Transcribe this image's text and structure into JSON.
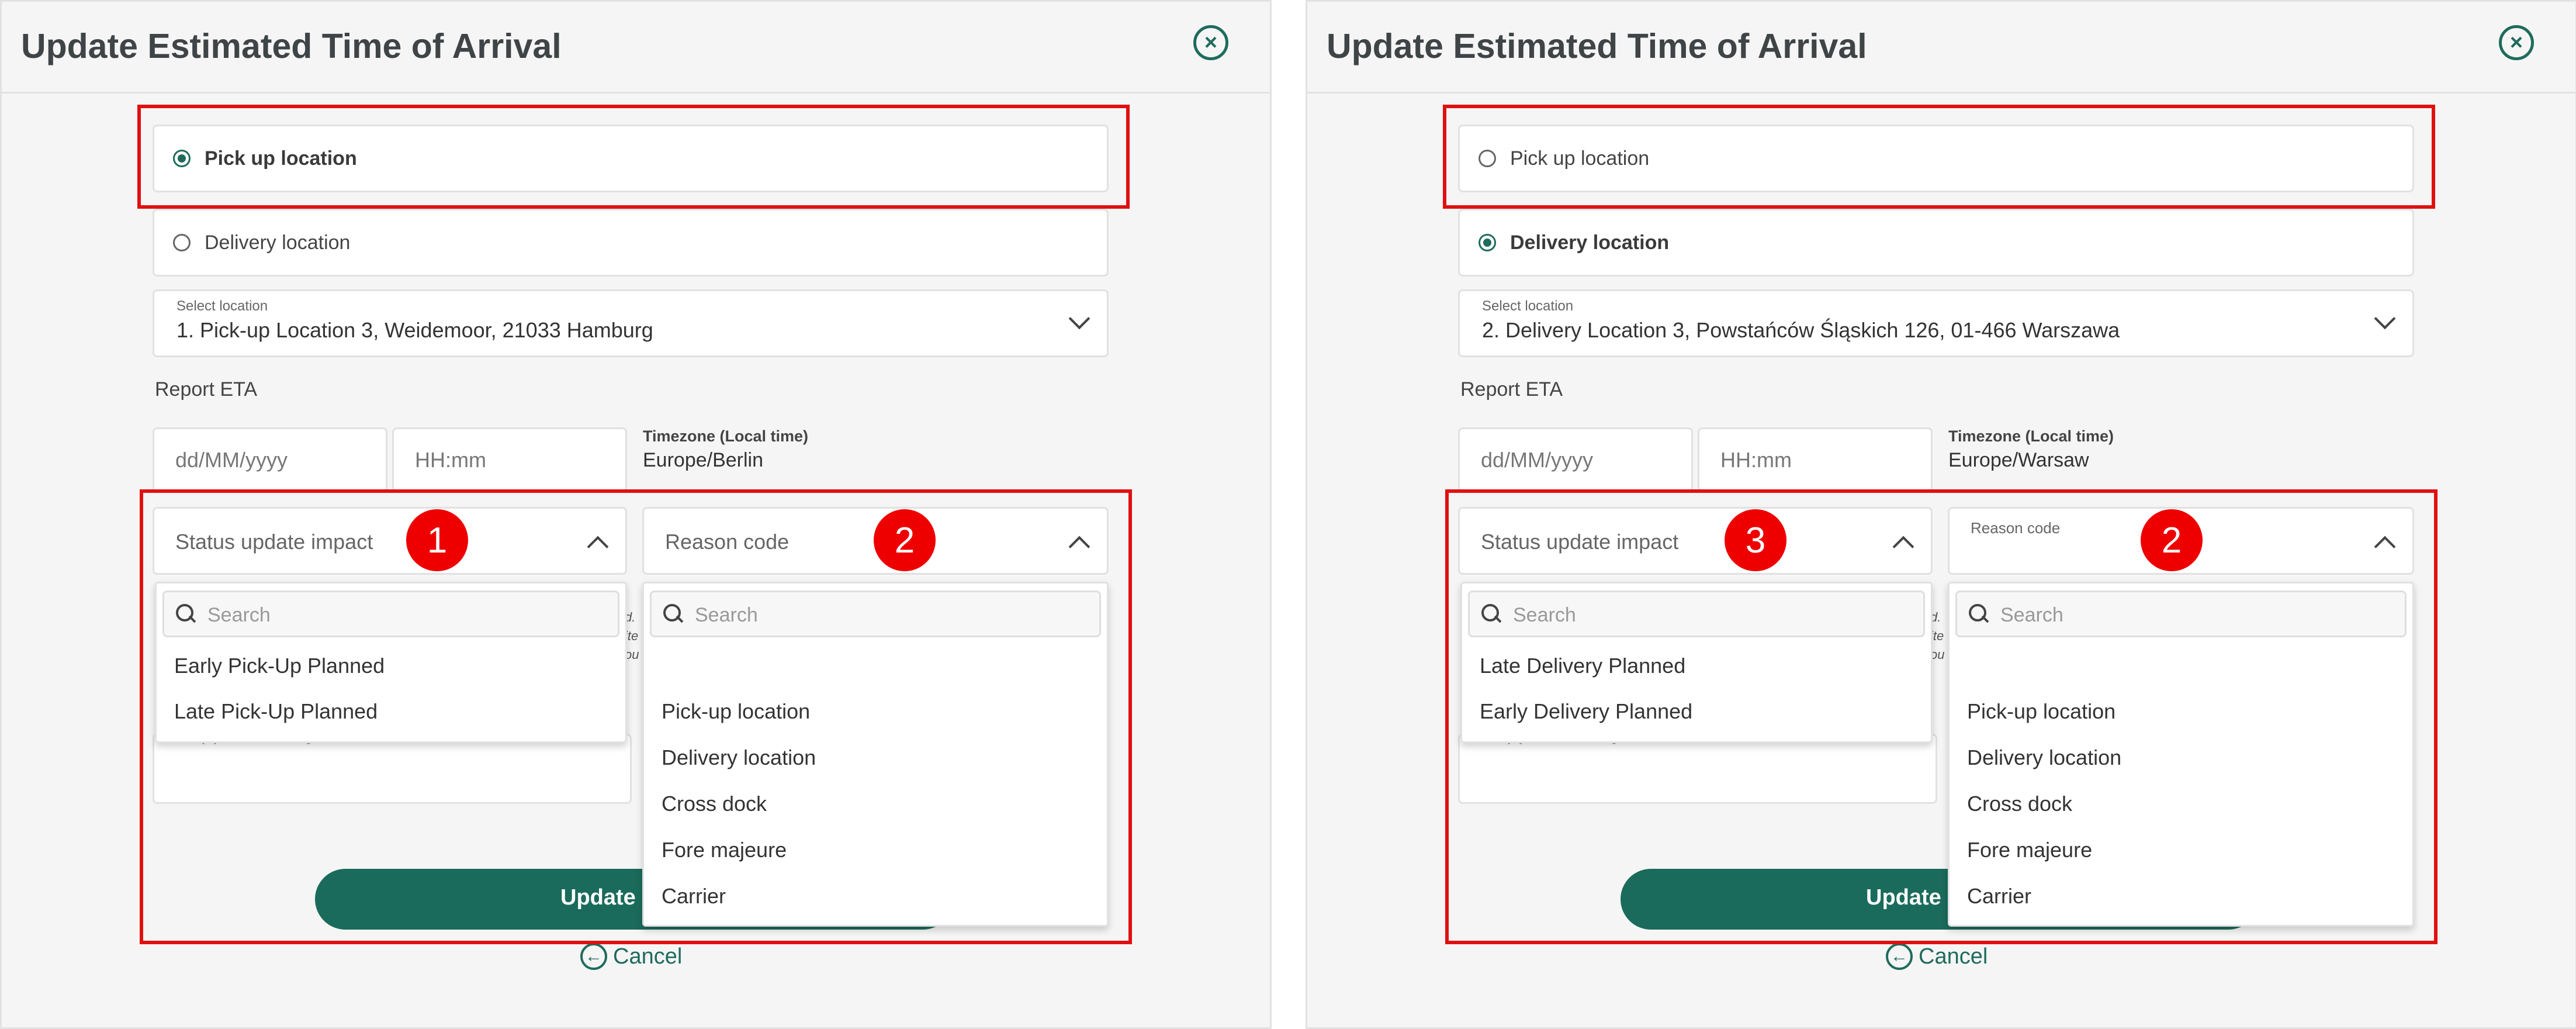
{
  "screens": [
    {
      "title": "Update Estimated Time of Arrival",
      "radio_pickup": {
        "label": "Pick up location",
        "selected": true
      },
      "radio_delivery": {
        "label": "Delivery location",
        "selected": false
      },
      "select_location": {
        "label": "Select location",
        "value": "1. Pick-up Location 3,  Weidemoor,   21033 Hamburg"
      },
      "report_eta_label": "Report ETA",
      "date_placeholder": "dd/MM/yyyy",
      "time_placeholder": "HH:mm",
      "timezone_label": "Timezone (Local time)",
      "timezone_value": "Europe/Berlin",
      "status_field": {
        "label": "Status update impact",
        "search_placeholder": "Search",
        "options": [
          "Early Pick-Up Planned",
          "Late Pick-Up Planned"
        ]
      },
      "reason_field": {
        "label": "Reason code",
        "search_placeholder": "Search",
        "options": [
          "Pick-up location",
          "Delivery location",
          "Cross dock",
          "Fore majeure",
          "Carrier"
        ]
      },
      "supplementary_placeholder": "Supplementary information",
      "update_button_label": "Update s",
      "cancel_label": "Cancel",
      "badges": [
        "1",
        "2"
      ]
    },
    {
      "title": "Update Estimated Time of Arrival",
      "radio_pickup": {
        "label": "Pick up location",
        "selected": false
      },
      "radio_delivery": {
        "label": "Delivery location",
        "selected": true
      },
      "select_location": {
        "label": "Select location",
        "value": "2. Delivery Location 3,  Powstańców Śląskich 126,   01-466 Warszawa"
      },
      "report_eta_label": "Report ETA",
      "date_placeholder": "dd/MM/yyyy",
      "time_placeholder": "HH:mm",
      "timezone_label": "Timezone (Local time)",
      "timezone_value": "Europe/Warsaw",
      "status_field": {
        "label": "Status update impact",
        "search_placeholder": "Search",
        "options": [
          "Late Delivery Planned",
          "Early Delivery Planned"
        ]
      },
      "reason_field": {
        "label": "Reason code",
        "search_placeholder": "Search",
        "options": [
          "Pick-up location",
          "Delivery location",
          "Cross dock",
          "Fore majeure",
          "Carrier"
        ]
      },
      "supplementary_placeholder": "Supplementary information",
      "update_button_label": "Update s",
      "cancel_label": "Cancel",
      "badges": [
        "3",
        "2"
      ]
    }
  ],
  "icons": {
    "close": "close-circle-icon",
    "cancel": "arrow-left-circle-icon",
    "search": "search-icon",
    "chevron": "chevron-icon"
  },
  "colors": {
    "primary": "#1a6b5b",
    "highlight": "#e01010",
    "badge": "#ee0000"
  }
}
